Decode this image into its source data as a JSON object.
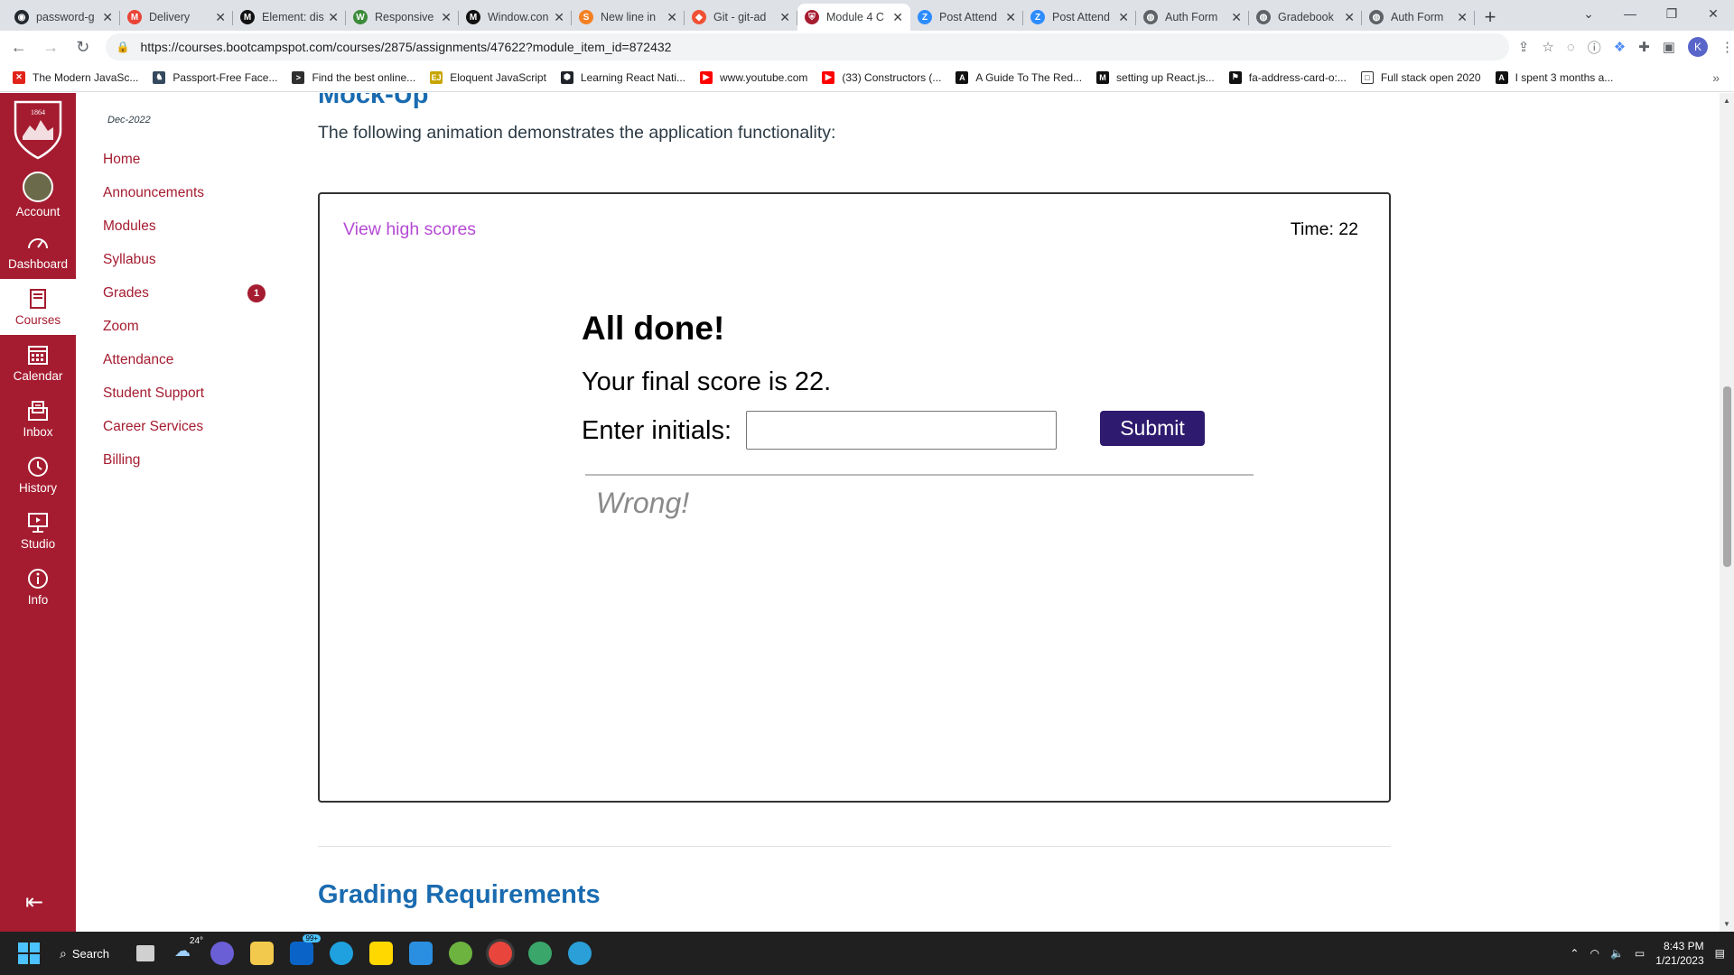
{
  "browser": {
    "tabs": [
      {
        "title": "password-g",
        "color": "#24292f",
        "glyph": "◉"
      },
      {
        "title": "Delivery",
        "color": "#ea4335",
        "glyph": "M"
      },
      {
        "title": "Element: dis",
        "color": "#111111",
        "glyph": "M"
      },
      {
        "title": "Responsive",
        "color": "#3b8b3b",
        "glyph": "W"
      },
      {
        "title": "Window.con",
        "color": "#111111",
        "glyph": "M"
      },
      {
        "title": "New line in",
        "color": "#f48024",
        "glyph": "S"
      },
      {
        "title": "Git - git-ad",
        "color": "#f05133",
        "glyph": "◆"
      },
      {
        "title": "Module 4 C",
        "color": "#a51c30",
        "glyph": "⛨",
        "active": true
      },
      {
        "title": "Post Attend",
        "color": "#2d8cff",
        "glyph": "Z"
      },
      {
        "title": "Post Attend",
        "color": "#2d8cff",
        "glyph": "Z"
      },
      {
        "title": "Auth Form",
        "color": "#5f6368",
        "glyph": "◍"
      },
      {
        "title": "Gradebook",
        "color": "#5f6368",
        "glyph": "◍"
      },
      {
        "title": "Auth Form",
        "color": "#5f6368",
        "glyph": "◍"
      }
    ],
    "new_tab_label": "+",
    "url": "https://courses.bootcampspot.com/courses/2875/assignments/47622?module_item_id=872432",
    "profile_initial": "K",
    "bookmarks": [
      {
        "label": "The Modern JavaSc...",
        "color": "#e2231a",
        "glyph": "✕"
      },
      {
        "label": "Passport-Free Face...",
        "color": "#34495e",
        "glyph": "♞"
      },
      {
        "label": "Find the best online...",
        "color": "#2f2f2f",
        "glyph": ">"
      },
      {
        "label": "Eloquent JavaScript",
        "color": "#c7a500",
        "glyph": "EJ"
      },
      {
        "label": "Learning React Nati...",
        "color": "#20232a",
        "glyph": "⬢"
      },
      {
        "label": "www.youtube.com",
        "color": "#ff0000",
        "glyph": "▶"
      },
      {
        "label": "(33) Constructors (...",
        "color": "#ff0000",
        "glyph": "▶"
      },
      {
        "label": "A Guide To The Red...",
        "color": "#111111",
        "glyph": "A"
      },
      {
        "label": "setting up React.js...",
        "color": "#111111",
        "glyph": "M"
      },
      {
        "label": "fa-address-card-o:...",
        "color": "#111111",
        "glyph": "⚑"
      },
      {
        "label": "Full stack open 2020",
        "color": "#ffffff",
        "glyph": "□"
      },
      {
        "label": "I spent 3 months a...",
        "color": "#111111",
        "glyph": "A"
      }
    ],
    "bookmarks_more": "»"
  },
  "global_nav": {
    "items": [
      {
        "key": "account",
        "label": "Account"
      },
      {
        "key": "dashboard",
        "label": "Dashboard"
      },
      {
        "key": "courses",
        "label": "Courses"
      },
      {
        "key": "calendar",
        "label": "Calendar"
      },
      {
        "key": "inbox",
        "label": "Inbox"
      },
      {
        "key": "history",
        "label": "History"
      },
      {
        "key": "studio",
        "label": "Studio"
      },
      {
        "key": "info",
        "label": "Info"
      }
    ],
    "active": "courses"
  },
  "course_nav": {
    "term": "Dec-2022",
    "items": [
      "Home",
      "Announcements",
      "Modules",
      "Syllabus",
      "Grades",
      "Zoom",
      "Attendance",
      "Student Support",
      "Career Services",
      "Billing"
    ],
    "grades_badge": "1"
  },
  "content": {
    "section_heading": "Mock-Up",
    "intro": "The following animation demonstrates the application functionality:",
    "demo": {
      "view_high_scores": "View high scores",
      "timer": "Time: 22",
      "title": "All done!",
      "final_score": "Your final score is 22.",
      "initials_label": "Enter initials:",
      "initials_value": "",
      "submit_label": "Submit",
      "feedback": "Wrong!"
    },
    "next_heading": "Grading Requirements"
  },
  "taskbar": {
    "search_label": "Search",
    "weather": "24°",
    "mail_badge": "99+",
    "time": "8:43 PM",
    "date": "1/21/2023"
  }
}
